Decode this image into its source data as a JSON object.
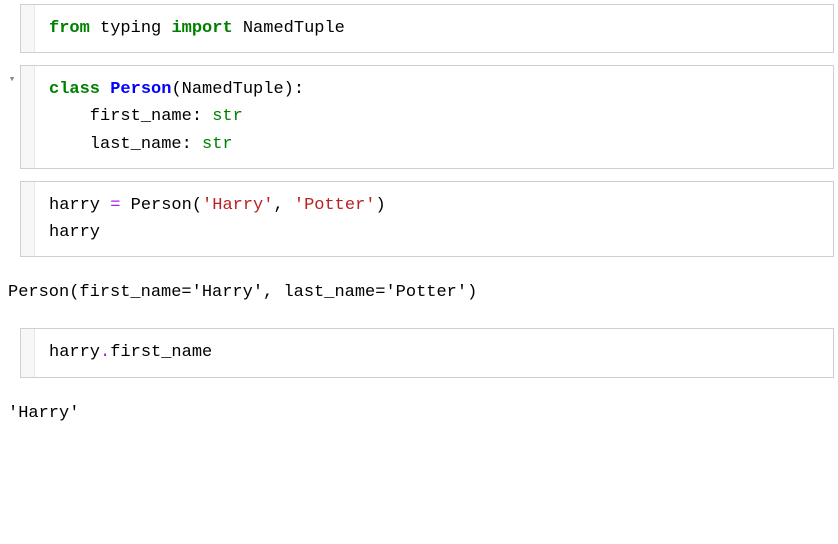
{
  "cells": {
    "c1": {
      "l1": {
        "from": "from",
        "typing": " typing ",
        "import": "import",
        "named": " NamedTuple"
      }
    },
    "c2": {
      "l1": {
        "class": "class",
        "sp1": " ",
        "person": "Person",
        "open": "(NamedTuple):"
      },
      "l2": {
        "indent": "    first_name: ",
        "type": "str"
      },
      "l3": {
        "indent": "    last_name: ",
        "type": "str"
      }
    },
    "c3": {
      "l1": {
        "assign": "harry ",
        "eq": "=",
        "call": " Person(",
        "s1": "'Harry'",
        "comma": ", ",
        "s2": "'Potter'",
        "close": ")"
      },
      "l2": {
        "expr": "harry"
      }
    },
    "c4": {
      "l1": {
        "expr": "harry",
        "dot": ".",
        "attr": "first_name"
      }
    }
  },
  "outputs": {
    "o1": "Person(first_name='Harry', last_name='Potter')",
    "o2": "'Harry'"
  },
  "icons": {
    "collapse": "▾"
  }
}
